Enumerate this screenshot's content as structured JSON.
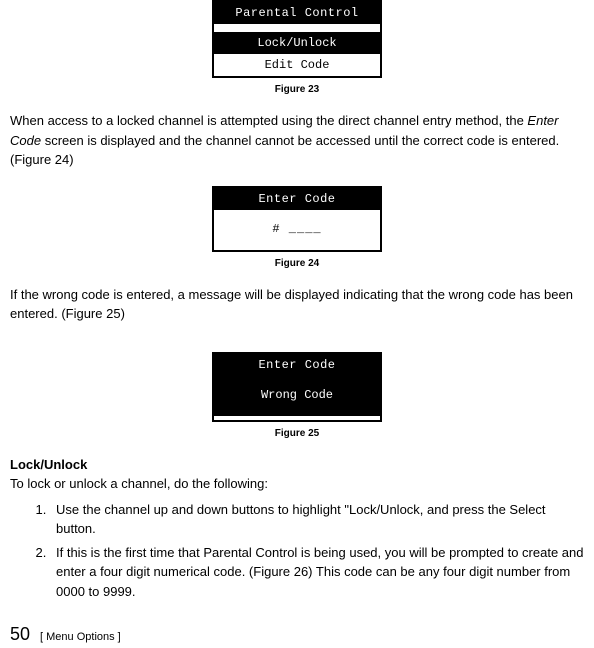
{
  "figure23": {
    "title": "Parental Control",
    "row1": "Lock/Unlock",
    "row2": "Edit Code",
    "caption": "Figure 23"
  },
  "paragraph1_part1": "When access to a locked channel is attempted using the direct channel entry method, the ",
  "paragraph1_italic": "Enter Code",
  "paragraph1_part2": " screen is displayed and the channel cannot be accessed until the correct code is entered. (Figure 24)",
  "figure24": {
    "title": "Enter Code",
    "content": "# ____",
    "caption": "Figure 24"
  },
  "paragraph2": "If the wrong code is entered, a message will be displayed indicating that the wrong code has been entered. (Figure 25)",
  "figure25": {
    "title": "Enter Code",
    "content": "Wrong Code",
    "caption": "Figure 25"
  },
  "section_heading": "Lock/Unlock",
  "section_intro": "To lock or unlock a channel, do the following:",
  "list": {
    "item1": "Use the channel up and down buttons to highlight \"Lock/Unlock, and press the Select button.",
    "item2": "If this is the first time that Parental Control is being used, you will be prompted to create and enter a four digit numerical code. (Figure 26) This code can be any four digit number from 0000 to 9999."
  },
  "footer": {
    "page": "50",
    "label": "[ Menu Options ]"
  }
}
